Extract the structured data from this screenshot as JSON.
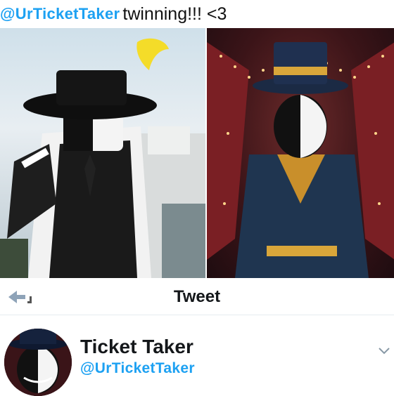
{
  "caption": {
    "handle": "@UrTicketTaker",
    "text": "twinning!!! <3"
  },
  "header": {
    "title": "Tweet"
  },
  "profile": {
    "name": "Ticket Taker",
    "handle": "@UrTicketTaker"
  },
  "colors": {
    "accent": "#1da1f2",
    "text": "#14171a"
  },
  "icons": {
    "back": "back-arrow-icon",
    "more": "chevron-down-icon"
  }
}
